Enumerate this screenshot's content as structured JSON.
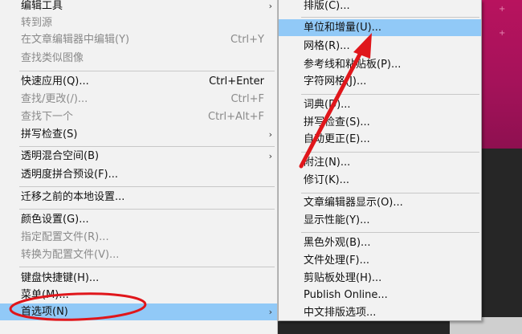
{
  "left_menu": {
    "items": [
      {
        "label": "编辑工具",
        "shortcut": "",
        "disabled": false,
        "submenu": true
      },
      {
        "label": "转到源",
        "shortcut": "",
        "disabled": true,
        "submenu": false
      },
      {
        "label": "在文章编辑器中编辑(Y)",
        "shortcut": "Ctrl+Y",
        "disabled": true,
        "submenu": false
      },
      {
        "label": "查找类似图像",
        "shortcut": "",
        "disabled": true,
        "submenu": false
      },
      {
        "label": "快速应用(Q)...",
        "shortcut": "Ctrl+Enter",
        "disabled": false,
        "submenu": false
      },
      {
        "label": "查找/更改(/)...",
        "shortcut": "Ctrl+F",
        "disabled": true,
        "submenu": false
      },
      {
        "label": "查找下一个",
        "shortcut": "Ctrl+Alt+F",
        "disabled": true,
        "submenu": false
      },
      {
        "label": "拼写检查(S)",
        "shortcut": "",
        "disabled": false,
        "submenu": true
      },
      {
        "label": "透明混合空间(B)",
        "shortcut": "",
        "disabled": false,
        "submenu": true
      },
      {
        "label": "透明度拼合预设(F)...",
        "shortcut": "",
        "disabled": false,
        "submenu": false
      },
      {
        "label": "迁移之前的本地设置...",
        "shortcut": "",
        "disabled": false,
        "submenu": false
      },
      {
        "label": "颜色设置(G)...",
        "shortcut": "",
        "disabled": false,
        "submenu": false
      },
      {
        "label": "指定配置文件(R)...",
        "shortcut": "",
        "disabled": true,
        "submenu": false
      },
      {
        "label": "转换为配置文件(V)...",
        "shortcut": "",
        "disabled": true,
        "submenu": false
      },
      {
        "label": "键盘快捷键(H)...",
        "shortcut": "",
        "disabled": false,
        "submenu": false
      },
      {
        "label": "菜单(M)...",
        "shortcut": "",
        "disabled": false,
        "submenu": false
      },
      {
        "label": "首选项(N)",
        "shortcut": "",
        "disabled": false,
        "submenu": true,
        "highlighted": true
      }
    ]
  },
  "right_menu": {
    "items": [
      {
        "label": "排版(C)..."
      },
      {
        "label": "单位和增量(U)...",
        "highlighted": true
      },
      {
        "label": "网格(R)..."
      },
      {
        "label": "参考线和粘贴板(P)..."
      },
      {
        "label": "字符网格(J)..."
      },
      {
        "label": "词典(D)..."
      },
      {
        "label": "拼写检查(S)..."
      },
      {
        "label": "自动更正(E)..."
      },
      {
        "label": "附注(N)..."
      },
      {
        "label": "修订(K)..."
      },
      {
        "label": "文章编辑器显示(O)..."
      },
      {
        "label": "显示性能(Y)..."
      },
      {
        "label": "黑色外观(B)..."
      },
      {
        "label": "文件处理(F)..."
      },
      {
        "label": "剪贴板处理(H)..."
      },
      {
        "label": "Publish Online..."
      },
      {
        "label": "中文排版选项..."
      }
    ]
  },
  "glyphs": {
    "submenu_arrow": "›",
    "bg_mark": "+"
  },
  "colors": {
    "menu_bg": "#f2f2f2",
    "highlight": "#91c9f7",
    "disabled_text": "#8a8a8a",
    "annotation_red": "#e0161b",
    "app_accent": "#b8135e"
  },
  "annotations": {
    "ellipse_target": "首选项(N)",
    "arrow_target": "单位和增量(U)..."
  }
}
